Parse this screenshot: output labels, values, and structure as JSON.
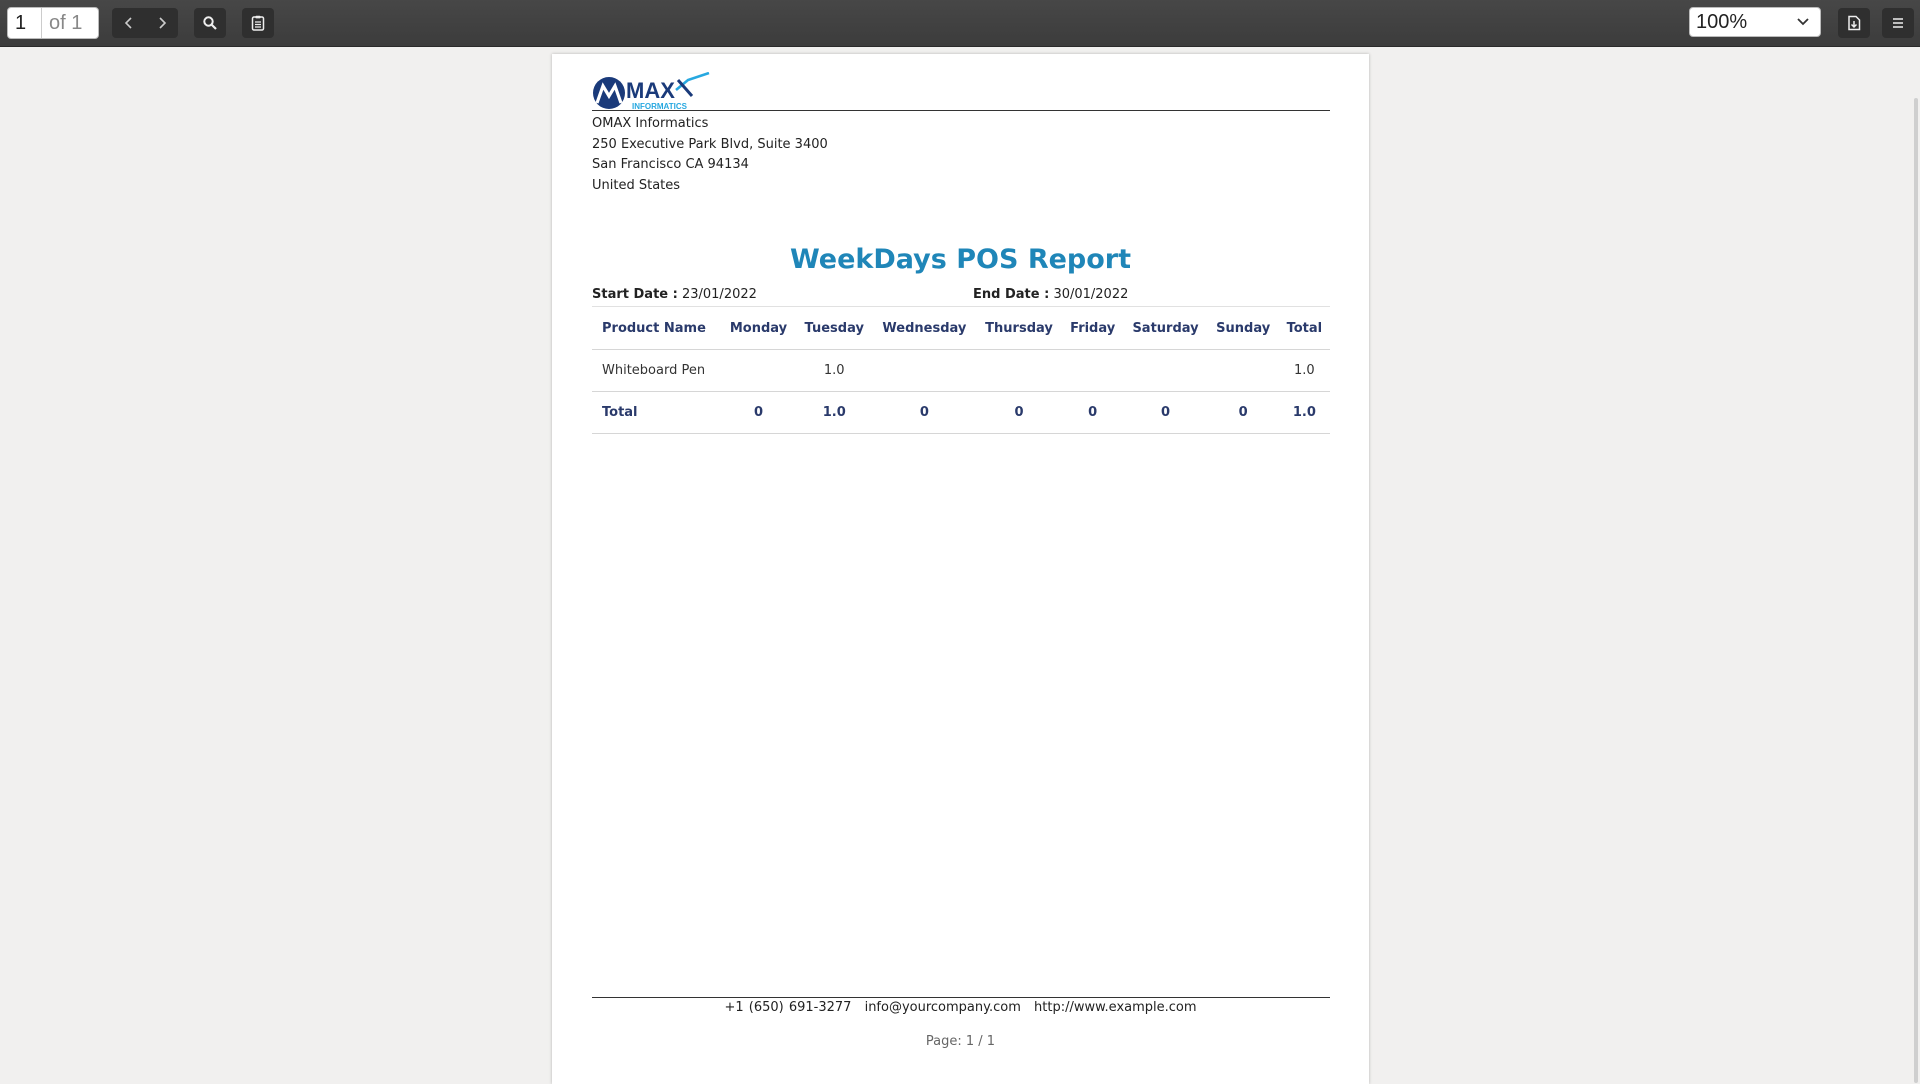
{
  "toolbar": {
    "page_current": "1",
    "page_of": "of 1",
    "zoom": "100%"
  },
  "icons": {
    "prev": "chevron-left-icon",
    "next": "chevron-right-icon",
    "search": "search-icon",
    "sidebar": "document-outline-icon",
    "zoom_dropdown": "chevron-down-icon",
    "download": "download-document-icon",
    "menu": "hamburger-menu-icon"
  },
  "colors": {
    "title": "#1f86b8",
    "table_header": "#2a3a6b",
    "toolbar": "#424242"
  },
  "logo": {
    "text_main": "MAX",
    "text_sub": "INFORMATICS"
  },
  "company": {
    "name": "OMAX Informatics",
    "address1": "250 Executive Park Blvd, Suite 3400",
    "address2": "San Francisco CA 94134",
    "country": "United States"
  },
  "report": {
    "title": "WeekDays POS Report",
    "start_label": "Start Date :",
    "start_value": "23/01/2022",
    "end_label": "End Date :",
    "end_value": "30/01/2022",
    "columns": [
      "Product Name",
      "Monday",
      "Tuesday",
      "Wednesday",
      "Thursday",
      "Friday",
      "Saturday",
      "Sunday",
      "Total"
    ],
    "rows": [
      [
        "Whiteboard Pen",
        "",
        "1.0",
        "",
        "",
        "",
        "",
        "",
        "1.0"
      ]
    ],
    "total_row": [
      "Total",
      "0",
      "1.0",
      "0",
      "0",
      "0",
      "0",
      "0",
      "1.0"
    ]
  },
  "footer": {
    "phone": "+1 (650) 691-3277",
    "email": "info@yourcompany.com",
    "website": "http://www.example.com",
    "page": "Page: 1 / 1"
  }
}
